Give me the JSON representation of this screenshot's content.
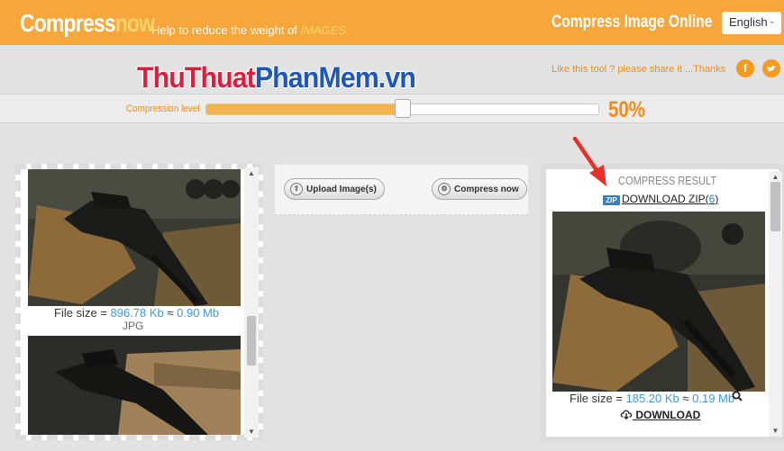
{
  "header": {
    "logo_main": "Compress",
    "logo_accent": "now",
    "tagline_prefix": "Help to reduce the weight of ",
    "tagline_emph": "IMAGES.",
    "title": "Compress Image Online",
    "language": "English"
  },
  "watermark": {
    "part1": "ThuThuat",
    "part2": "PhanMem.vn"
  },
  "share": {
    "text": "Like this tool ? please share it ...Thanks",
    "facebook": "f",
    "twitter": "t"
  },
  "compression": {
    "label": "Compression level",
    "value_text": "50%",
    "level": 0.5
  },
  "actions": {
    "upload_label": "Upload Image(s)",
    "compress_label": "Compress now"
  },
  "left_files": [
    {
      "prefix": "File size = ",
      "size_kb": "896.78 Kb",
      "approx": " ≈ ",
      "size_mb": "0.90 Mb",
      "type": "JPG"
    }
  ],
  "result": {
    "title": "COMPRESS RESULT",
    "zip_badge": "ZIP",
    "zip_label": "DOWNLOAD ZIP(",
    "zip_count": "6",
    "zip_close": ")",
    "file_prefix": "File size = ",
    "size_kb": "185.20 Kb",
    "approx": " ≈ ",
    "size_mb": "0.19 Mb",
    "download_label": "DOWNLOAD"
  },
  "colors": {
    "header": "#f7a63c",
    "accent": "#f08b1c",
    "link_blue": "#3b9ae1",
    "watermark_red": "#d8203f",
    "watermark_blue": "#1f57b8"
  }
}
